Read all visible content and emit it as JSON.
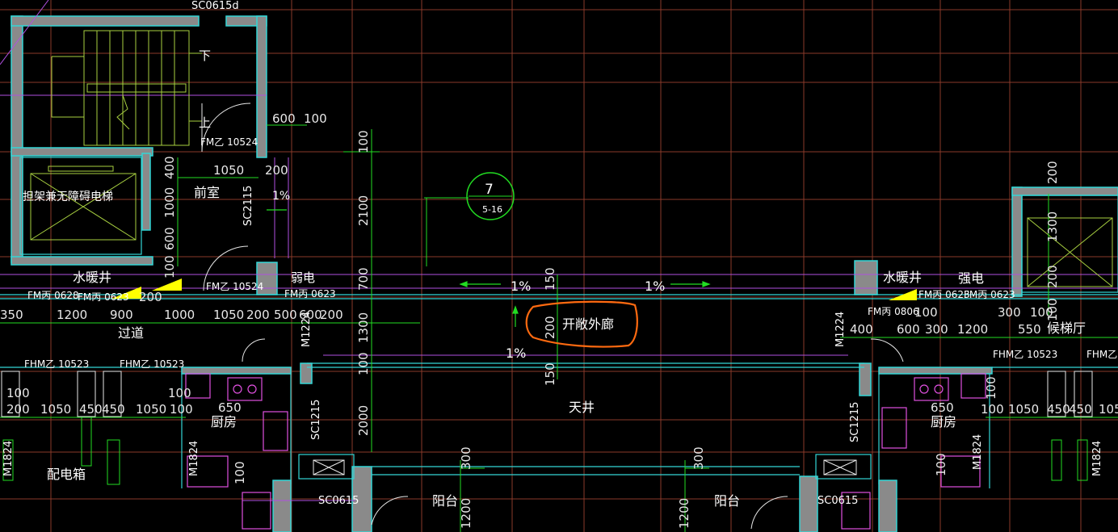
{
  "colors": {
    "background": "#000000",
    "wall": "#33d6d6",
    "wall_fill": "#8a8a8a",
    "axis": "#8a3a2a",
    "dimension": "#22dd22",
    "furniture": "#e050e0",
    "stair": "#a8d040",
    "text": "#ffffff",
    "highlight": "#ff6a10",
    "marker": "#ffff00"
  },
  "labels": {
    "door_sc0615d": "SC0615d",
    "stair_down": "下",
    "stair_up": "上",
    "fmz10524_top": "FM乙 10524",
    "fmz10524_mid": "FM乙 10524",
    "elevator": "担架兼无障碍电梯",
    "front_room": "前室",
    "sc2115": "SC2115",
    "pct_front": "1%",
    "water_well_left": "水暖井",
    "weak_elec": "弱电",
    "fm_c0628": "FM丙 0628",
    "fm_c0623_a": "FM丙 0623",
    "fm_c0623_b": "FM丙 0623",
    "corridor": "过道",
    "m1224_left": "M1224",
    "m1224_right": "M1224",
    "fhmz_a": "FHM乙 10523",
    "fhmz_b": "FHM乙 10523",
    "fhmz_c": "FHM乙 10523",
    "fhmz_d": "FHM乙",
    "detail_no": "7",
    "detail_sheet": "5-16",
    "pct_left": "1%",
    "pct_right": "1%",
    "pct_bottom": "1%",
    "open_corridor": "开敞外廊",
    "courtyard": "天井",
    "kitchen_left": "厨房",
    "kitchen_right": "厨房",
    "sc1215_left": "SC1215",
    "sc1215_right": "SC1215",
    "m1824_a": "M1824",
    "m1824_b": "M1824",
    "m1824_c": "M1824",
    "m1824_d": "M1824",
    "elec_box": "配电箱",
    "balcony_left": "阳台",
    "balcony_right": "阳台",
    "sc0615_left": "SC0615",
    "sc0615_right": "SC0615",
    "water_well_right": "水暖井",
    "strong_elec": "强电",
    "fm_c0806": "FM丙 0806",
    "fm_c0623_c": "FM丙 0623",
    "fm_c0623_d": "FM丙 0623",
    "elevator_hall": "候梯厅"
  },
  "dims": {
    "d600": "600",
    "d100a": "100",
    "d1050_top": "1050",
    "d200a": "200",
    "d400": "400",
    "d1000": "1000",
    "d600b": "600",
    "d100b": "100",
    "d100_v1": "100",
    "d2100": "2100",
    "d700": "700",
    "d150_top": "150",
    "d1300": "1300",
    "d200_mid": "200",
    "d100_v2": "100",
    "d150_bot": "150",
    "d2000": "2000",
    "d300_l": "300",
    "d300_r": "300",
    "d1200_l": "1200",
    "d1200_r": "1200",
    "d200_vr": "200",
    "d1300_r": "1300",
    "d200_vr2": "200",
    "d100_vr": "100",
    "row_350": "350",
    "row_1200": "1200",
    "row_900": "900",
    "row_200": "200",
    "row_1000": "1000",
    "row_1050": "1050",
    "row_200b": "200",
    "row_500": "500",
    "row_600": "600",
    "row_200c": "200",
    "row_100": "100",
    "row_400": "400",
    "row_600r": "600",
    "row_300r": "300",
    "row_1200r": "1200",
    "row_550": "550",
    "row_100r": "100",
    "row_300r2": "300",
    "k_100": "100",
    "k_200": "200",
    "k_1050": "1050",
    "k_450a": "450",
    "k_450b": "450",
    "k_1050b": "1050",
    "k_100b": "100",
    "k_650": "650",
    "k_100c": "100",
    "k_650r": "650",
    "k_100r": "100",
    "k_1050r": "1050",
    "k_450r": "450",
    "k_450r2": "450",
    "k_105r": "105",
    "k_100v": "100",
    "k_100vr": "100",
    "k_100kr": "100",
    "k_1215": "1215"
  }
}
